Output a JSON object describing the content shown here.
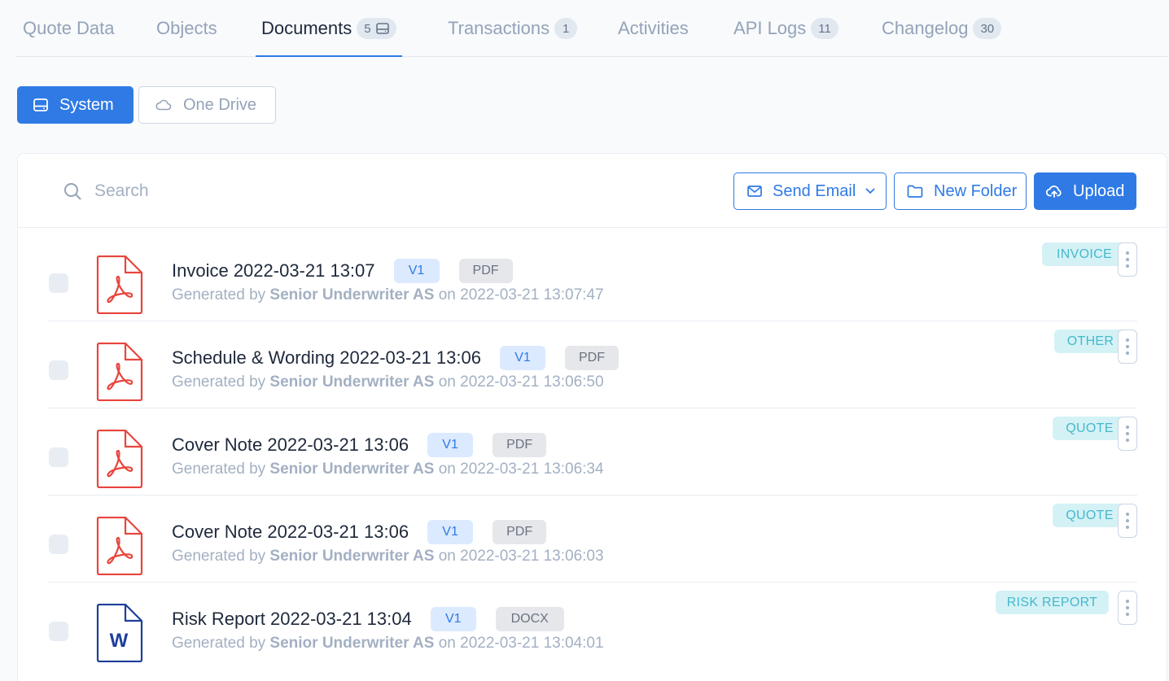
{
  "tabs": [
    {
      "label": "Quote Data",
      "count": null
    },
    {
      "label": "Objects",
      "count": null
    },
    {
      "label": "Documents",
      "count": "5",
      "icon": "drive-icon",
      "active": true
    },
    {
      "label": "Transactions",
      "count": "1"
    },
    {
      "label": "Activities",
      "count": null
    },
    {
      "label": "API Logs",
      "count": "11"
    },
    {
      "label": "Changelog",
      "count": "30"
    }
  ],
  "sources": {
    "system_label": "System",
    "onedrive_label": "One Drive"
  },
  "toolbar": {
    "search_placeholder": "Search",
    "send_email_label": "Send Email",
    "new_folder_label": "New Folder",
    "upload_label": "Upload"
  },
  "documents": [
    {
      "title": "Invoice 2022-03-21 13:07",
      "version": "V1",
      "type": "PDF",
      "icon": "pdf-icon",
      "generated_prefix": "Generated by",
      "author": "Senior Underwriter AS",
      "generated_on": "on 2022-03-21 13:07:47",
      "category": "INVOICE"
    },
    {
      "title": "Schedule & Wording 2022-03-21 13:06",
      "version": "V1",
      "type": "PDF",
      "icon": "pdf-icon",
      "generated_prefix": "Generated by",
      "author": "Senior Underwriter AS",
      "generated_on": "on 2022-03-21 13:06:50",
      "category": "OTHER"
    },
    {
      "title": "Cover Note 2022-03-21 13:06",
      "version": "V1",
      "type": "PDF",
      "icon": "pdf-icon",
      "generated_prefix": "Generated by",
      "author": "Senior Underwriter AS",
      "generated_on": "on 2022-03-21 13:06:34",
      "category": "QUOTE"
    },
    {
      "title": "Cover Note 2022-03-21 13:06",
      "version": "V1",
      "type": "PDF",
      "icon": "pdf-icon",
      "generated_prefix": "Generated by",
      "author": "Senior Underwriter AS",
      "generated_on": "on 2022-03-21 13:06:03",
      "category": "QUOTE"
    },
    {
      "title": "Risk Report 2022-03-21 13:04",
      "version": "V1",
      "type": "DOCX",
      "icon": "word-icon",
      "icon_letter": "W",
      "generated_prefix": "Generated by",
      "author": "Senior Underwriter AS",
      "generated_on": "on 2022-03-21 13:04:01",
      "category": "RISK REPORT"
    }
  ],
  "colors": {
    "accent": "#2f7ae5",
    "pdf_red": "#e8453c",
    "word_blue": "#1e3f9a",
    "category_bg": "#d4f2f6",
    "category_text": "#46b8cd"
  }
}
